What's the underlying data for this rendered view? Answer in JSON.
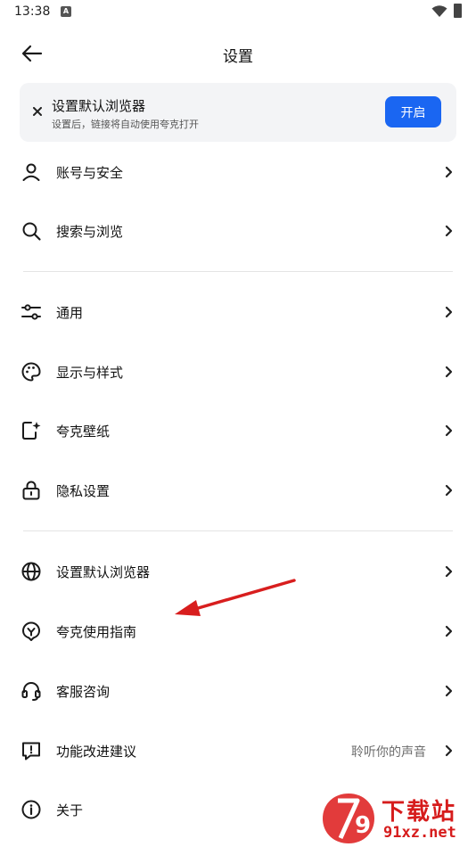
{
  "status_bar": {
    "time": "13:38",
    "notification_icon": "A"
  },
  "header": {
    "title": "设置",
    "back_icon": "arrow-left-icon"
  },
  "banner": {
    "title": "设置默认浏览器",
    "subtitle": "设置后，链接将自动使用夸克打开",
    "button_label": "开启"
  },
  "sections": {
    "account": [
      {
        "label": "账号与安全",
        "icon": "user-icon"
      },
      {
        "label": "搜索与浏览",
        "icon": "search-icon"
      }
    ],
    "general": [
      {
        "label": "通用",
        "icon": "sliders-icon"
      },
      {
        "label": "显示与样式",
        "icon": "palette-icon"
      },
      {
        "label": "夸克壁纸",
        "icon": "wallpaper-icon"
      },
      {
        "label": "隐私设置",
        "icon": "lock-icon"
      }
    ],
    "other": [
      {
        "label": "设置默认浏览器",
        "icon": "globe-icon"
      },
      {
        "label": "夸克使用指南",
        "icon": "guide-icon"
      },
      {
        "label": "客服咨询",
        "icon": "headset-icon"
      },
      {
        "label": "功能改进建议",
        "icon": "feedback-icon",
        "value": "聆听你的声音"
      },
      {
        "label": "关于",
        "icon": "info-icon"
      }
    ]
  },
  "watermark": {
    "top_text": "下载站",
    "bottom_text": "91xz.net",
    "badge_text": "9"
  }
}
